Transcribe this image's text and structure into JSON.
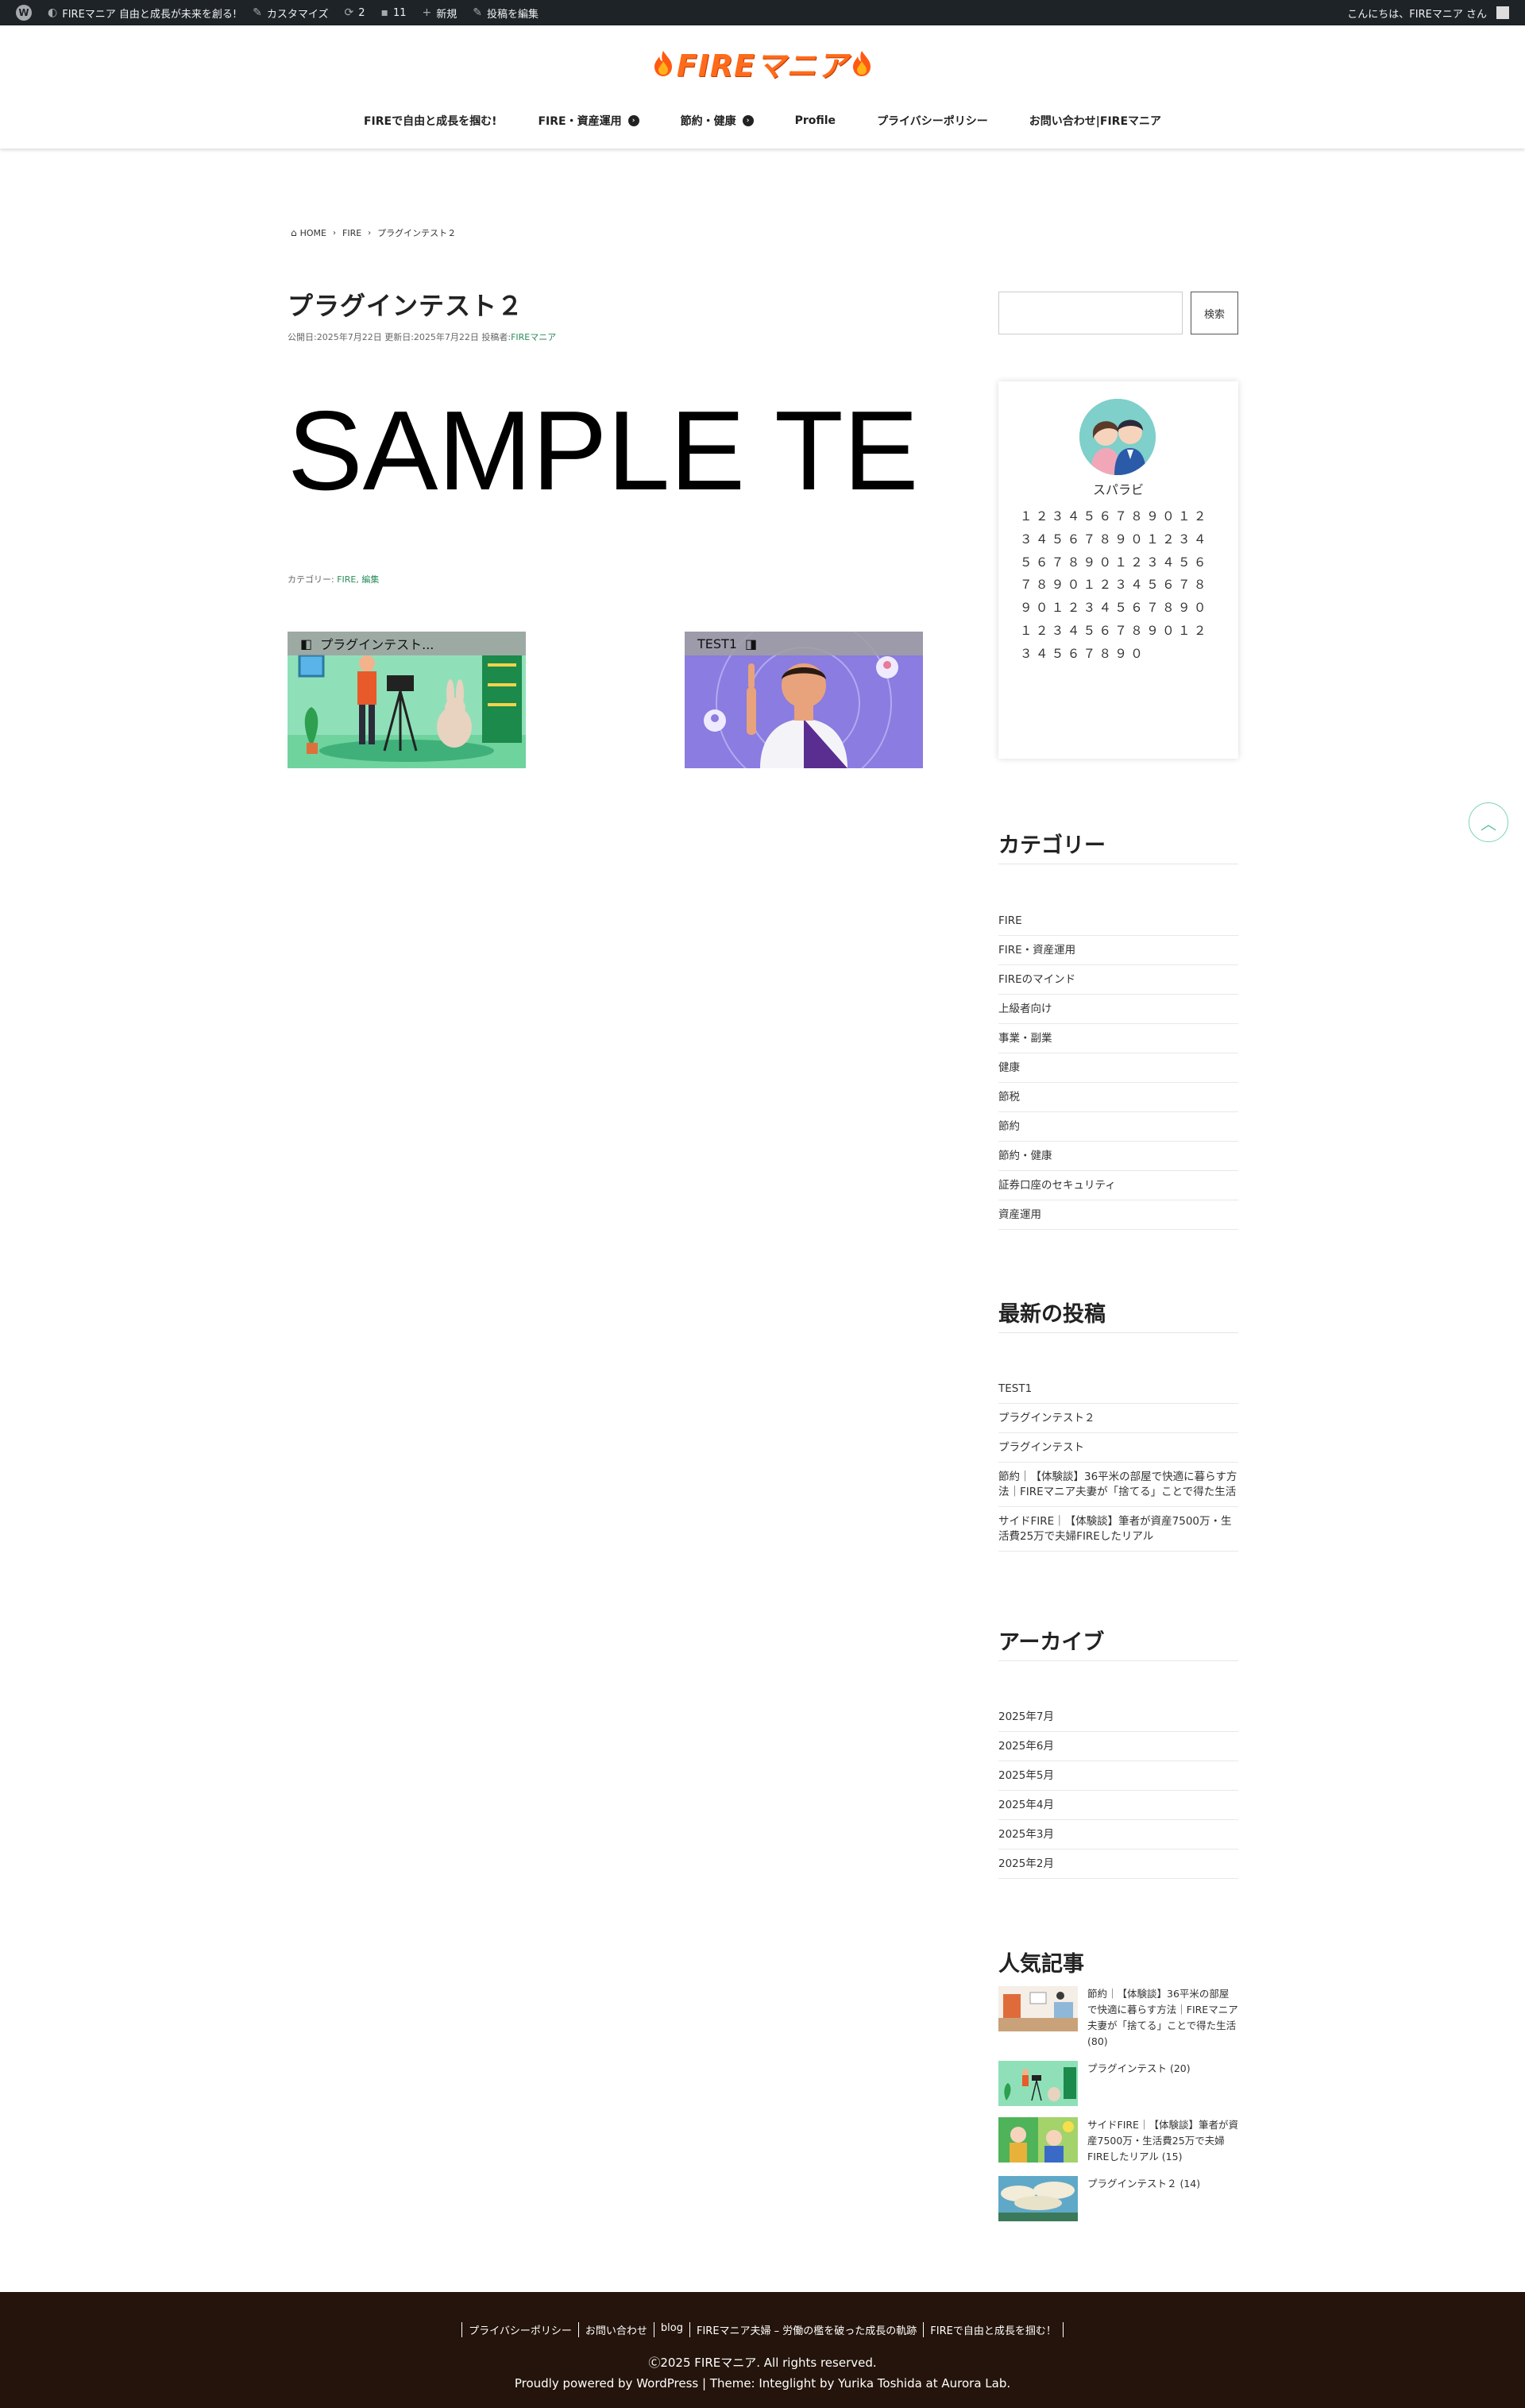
{
  "adminbar": {
    "site_name": "FIREマニア 自由と成長が未来を創る!",
    "customize": "カスタマイズ",
    "updates_count": "2",
    "comments_count": "11",
    "new_label": "新規",
    "edit_post": "投稿を編集",
    "greeting": "こんにちは、FIREマニア さん"
  },
  "header": {
    "logo_text": "FIREマニア",
    "nav": [
      {
        "label": "FIREで自由と成長を掴む!"
      },
      {
        "label": "FIRE・資産運用"
      },
      {
        "label": "節約・健康"
      },
      {
        "label": "Profile"
      },
      {
        "label": "プライバシーポリシー"
      },
      {
        "label": "お問い合わせ|FIREマニア"
      }
    ]
  },
  "breadcrumb": [
    "HOME",
    "FIRE",
    "プラグインテスト２"
  ],
  "post": {
    "title": "プラグインテスト２",
    "meta_prefix": "公開日:2025年7月22日 更新日:2025年7月22日 投稿者:",
    "author": "FIREマニア",
    "sample_text": "SAMPLE TE",
    "cats_prefix": "カテゴリー:",
    "cats": "FIRE, 編集"
  },
  "post_nav": {
    "prev_label": "プラグインテスト...",
    "next_label": "TEST1"
  },
  "sidebar": {
    "search_button": "検索",
    "profile_name": "スパラビ",
    "profile_text": "１２３４５６７８９０１２３４５６７８９０１２３４５６７８９０１２３４５６７８９０１２３４５６７８９０１２３４５６７８９０１２３４５６７８９０１２３４５６７８９０",
    "categories_title": "カテゴリー",
    "categories": [
      "FIRE",
      "FIRE・資産運用",
      "FIREのマインド",
      "上級者向け",
      "事業・副業",
      "健康",
      "節税",
      "節約",
      "節約・健康",
      "証券口座のセキュリティ",
      "資産運用"
    ],
    "recent_title": "最新の投稿",
    "recent": [
      "TEST1",
      "プラグインテスト２",
      "プラグインテスト",
      "節約｜【体験談】36平米の部屋で快適に暮らす方法｜FIREマニア夫妻が「捨てる」ことで得た生活",
      "サイドFIRE｜【体験談】筆者が資産7500万・生活費25万で夫婦FIREしたリアル"
    ],
    "archive_title": "アーカイブ",
    "archives": [
      "2025年7月",
      "2025年6月",
      "2025年5月",
      "2025年4月",
      "2025年3月",
      "2025年2月"
    ],
    "popular_title": "人気記事",
    "popular": [
      "節約｜【体験談】36平米の部屋で快適に暮らす方法｜FIREマニア夫妻が「捨てる」ことで得た生活 (80)",
      "プラグインテスト (20)",
      "サイドFIRE｜【体験談】筆者が資産7500万・生活費25万で夫婦FIREしたリアル (15)",
      "プラグインテスト２ (14)"
    ]
  },
  "footer": {
    "links": [
      "プライバシーポリシー",
      "お問い合わせ",
      "blog",
      "FIREマニア夫婦 – 労働の檻を破った成長の軌跡",
      "FIREで自由と成長を掴む！"
    ],
    "copyright": "Ⓒ2025 FIREマニア. All rights reserved.",
    "powered": "Proudly powered by WordPress | Theme: Integlight by Yurika Toshida at Aurora Lab."
  },
  "colors": {
    "accent": "#2a8c5c",
    "logo": "#ff6b1a",
    "adminbar": "#1d2327",
    "footer": "#24140b"
  }
}
